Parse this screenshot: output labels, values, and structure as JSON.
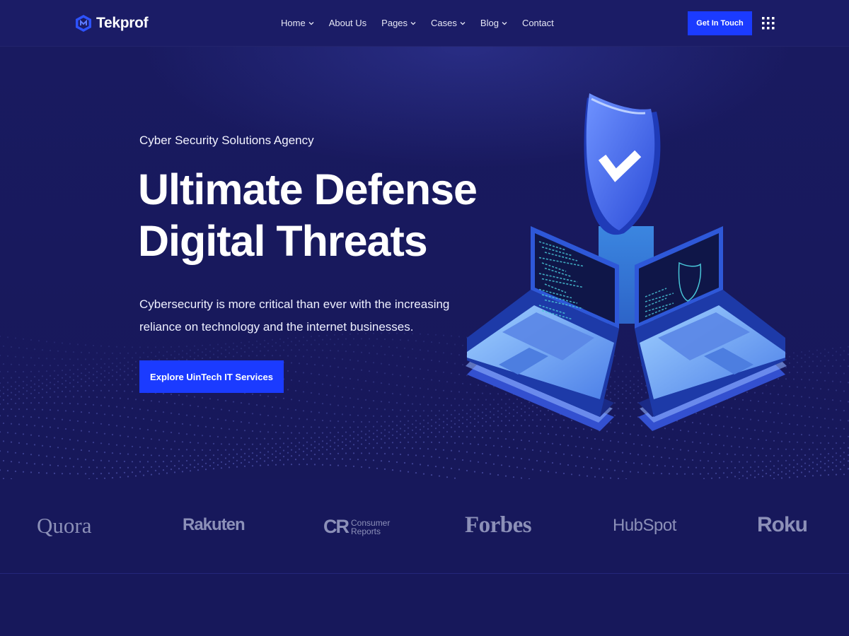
{
  "brand": {
    "name": "Tekprof"
  },
  "nav": [
    {
      "label": "Home",
      "dropdown": true
    },
    {
      "label": "About Us",
      "dropdown": false
    },
    {
      "label": "Pages",
      "dropdown": true
    },
    {
      "label": "Cases",
      "dropdown": true
    },
    {
      "label": "Blog",
      "dropdown": true
    },
    {
      "label": "Contact",
      "dropdown": false
    }
  ],
  "header": {
    "cta_label": "Get In Touch",
    "menu_icon": "grid-menu-icon"
  },
  "hero": {
    "eyebrow": "Cyber Security Solutions Agency",
    "title_line1": "Ultimate Defense",
    "title_line2": "Digital Threats",
    "description_line1": "Cybersecurity is more critical than ever with the increasing",
    "description_line2": "reliance on technology and the internet businesses.",
    "button_label": "Explore UinTech IT Services"
  },
  "brands": {
    "quora": "Quora",
    "rakuten": "Rakuten",
    "consumer_reports_mark": "CR",
    "consumer_reports_line1": "Consumer",
    "consumer_reports_line2": "Reports",
    "forbes": "Forbes",
    "hubspot": "HubSpot",
    "roku": "Roku"
  },
  "colors": {
    "background": "#17185b",
    "header": "#1b1c66",
    "accent": "#1b3bff",
    "brand_logo": "#8c90b8"
  }
}
